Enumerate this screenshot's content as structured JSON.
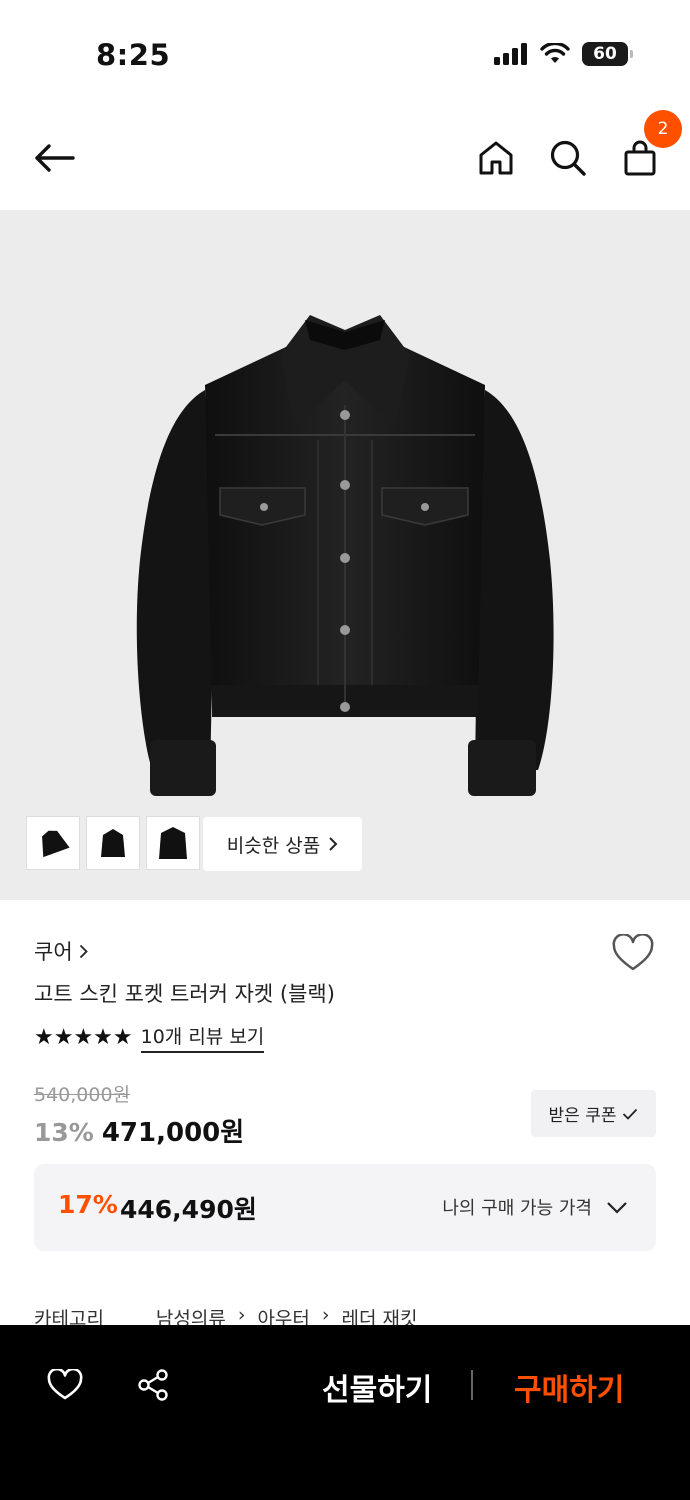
{
  "status": {
    "time": "8:25",
    "battery": "60"
  },
  "nav": {
    "cart_count": "2"
  },
  "similar_products_label": "비슷한 상품",
  "product": {
    "brand": "쿠어",
    "title": "고트 스킨 포켓 트러커 자켓 (블랙)",
    "stars": "★★★★★",
    "rating_out_of_5": 5,
    "review_link": "10개 리뷰 보기",
    "original_price": "540,000원",
    "discount": "13%",
    "price": "471,000원",
    "coupon_label": "받은 쿠폰"
  },
  "best_price": {
    "discount": "17%",
    "price": "446,490원",
    "label": "나의 구매 가능 가격"
  },
  "category": {
    "label": "카테고리",
    "path": [
      "남성의류",
      "아우터",
      "레더 재킷"
    ]
  },
  "bottom": {
    "gift": "선물하기",
    "buy": "구매하기"
  },
  "colors": {
    "accent": "#ff5000",
    "bottom_bar": "#000000"
  }
}
